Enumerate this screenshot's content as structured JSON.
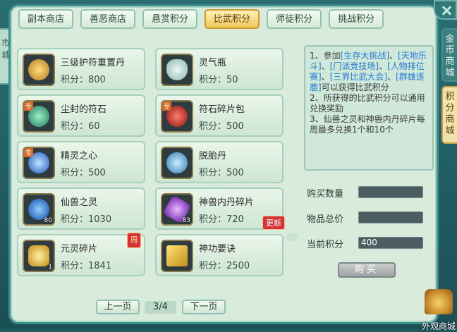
{
  "tabs": [
    {
      "label": "副本商店",
      "active": false
    },
    {
      "label": "善恶商店",
      "active": false
    },
    {
      "label": "悬赏积分",
      "active": false
    },
    {
      "label": "比武积分",
      "active": true
    },
    {
      "label": "师徒积分",
      "active": false
    },
    {
      "label": "挑战积分",
      "active": false
    }
  ],
  "side_tabs": {
    "gold_shop": "金币商城",
    "points_shop": "积分商城",
    "left_partial": "市城"
  },
  "points_prefix": "积分：",
  "items": [
    {
      "name": "三级护符重置丹",
      "points": "800",
      "icon": "gold-talisman-icon",
      "color": "#d99a2a"
    },
    {
      "name": "灵气瓶",
      "points": "50",
      "icon": "spirit-bottle-icon",
      "color": "#b8d8d0"
    },
    {
      "name": "尘封的符石",
      "points": "60",
      "icon": "sealed-runestone-icon",
      "color": "#3fb38a",
      "tag": "专"
    },
    {
      "name": "符石碎片包",
      "points": "500",
      "icon": "runestone-bag-icon",
      "color": "#b62a2a",
      "tag": "专"
    },
    {
      "name": "精灵之心",
      "points": "500",
      "icon": "elf-heart-icon",
      "color": "#3a7ad6",
      "tag": "专"
    },
    {
      "name": "脱胎丹",
      "points": "500",
      "icon": "rebirth-pill-icon",
      "color": "#4da6d8"
    },
    {
      "name": "仙兽之灵",
      "points": "1030",
      "icon": "beast-spirit-orb-icon",
      "color": "#2d7ee0",
      "qty": "80"
    },
    {
      "name": "神兽内丹碎片",
      "points": "720",
      "icon": "beast-core-shard-icon",
      "color": "#a04fd8",
      "qty": "83",
      "badge": "更新"
    },
    {
      "name": "元灵碎片",
      "points": "1841",
      "icon": "spirit-shard-icon",
      "color": "#e0b42a",
      "qty": "1",
      "badge_week": "周"
    },
    {
      "name": "神功要诀",
      "points": "2500",
      "icon": "skill-book-icon",
      "color": "#e2b62e"
    }
  ],
  "info_text": {
    "line1_a": "1、参加",
    "line1_link1": "[生存大挑战]",
    "line1_sep1": "、",
    "line1_link2": "[天地乐斗]",
    "line1_sep2": "、",
    "line1_link3": "[门派竞技场]",
    "line1_sep3": "、",
    "line1_link4": "[人物排位赛]",
    "line1_sep4": "、",
    "line1_link5": "[三界比武大会]",
    "line1_sep5": "、",
    "line1_link6": "[群雄逐鹿]",
    "line1_b": "可以获得比武积分",
    "line2": "2、所获得的比武积分可以通用兑换奖励",
    "line3": "3、仙兽之灵和神兽内丹碎片每周最多兑换1个和10个"
  },
  "purchase": {
    "qty_label": "购买数量",
    "qty_value": "",
    "total_label": "物品总价",
    "total_value": "",
    "current_label": "当前积分",
    "current_value": "400",
    "buy_label": "购买"
  },
  "pager": {
    "prev": "上一页",
    "page": "3/4",
    "next": "下一页"
  },
  "outer_shop_label": "外观商城"
}
